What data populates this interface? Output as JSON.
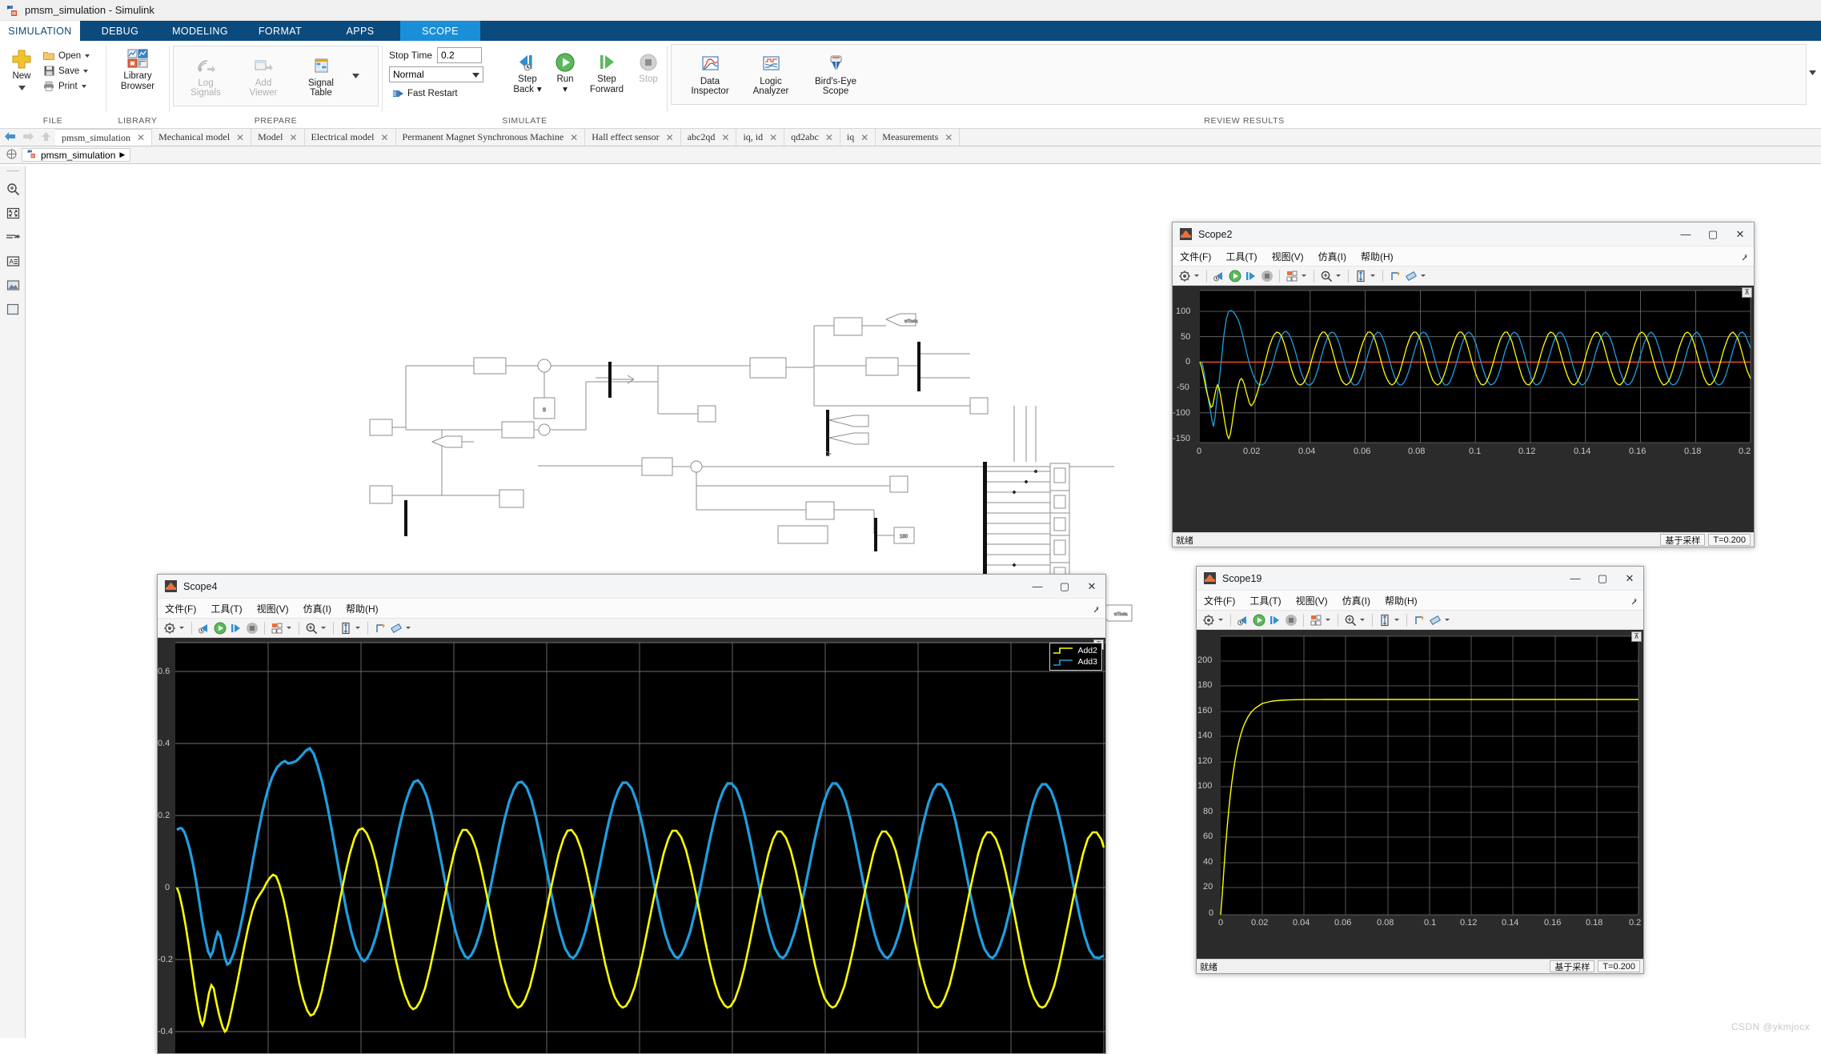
{
  "window": {
    "title": "pmsm_simulation - Simulink",
    "icon": "simulink-icon"
  },
  "ribbon": {
    "tabs": [
      {
        "label": "SIMULATION",
        "state": "active-white"
      },
      {
        "label": "DEBUG",
        "state": "normal"
      },
      {
        "label": "MODELING",
        "state": "normal"
      },
      {
        "label": "FORMAT",
        "state": "normal"
      },
      {
        "label": "APPS",
        "state": "normal"
      },
      {
        "label": "SCOPE",
        "state": "active-blue"
      }
    ],
    "groups": {
      "file": {
        "label": "FILE",
        "new_label": "New",
        "items": [
          {
            "label": "Open",
            "icon": "folder-open-icon",
            "has_caret": true
          },
          {
            "label": "Save",
            "icon": "save-disk-icon",
            "has_caret": true
          },
          {
            "label": "Print",
            "icon": "printer-icon",
            "has_caret": true
          }
        ]
      },
      "library": {
        "label": "LIBRARY",
        "button": {
          "line1": "Library",
          "line2": "Browser",
          "icon": "library-browser-icon"
        }
      },
      "prepare": {
        "label": "PREPARE",
        "buttons": [
          {
            "line1": "Log",
            "line2": "Signals",
            "icon": "log-signals-icon",
            "disabled": true
          },
          {
            "line1": "Add",
            "line2": "Viewer",
            "icon": "add-viewer-icon",
            "disabled": true
          },
          {
            "line1": "Signal",
            "line2": "Table",
            "icon": "signal-table-icon",
            "disabled": false
          }
        ]
      },
      "simulate": {
        "label": "SIMULATE",
        "stop_time_label": "Stop Time",
        "stop_time_value": "0.2",
        "mode_value": "Normal",
        "fast_restart_label": "Fast Restart",
        "buttons": [
          {
            "line1": "Step",
            "line2": "Back",
            "icon": "step-back-icon",
            "has_caret": true,
            "disabled": false
          },
          {
            "line1": "Run",
            "line2": "",
            "icon": "run-icon",
            "has_caret": true,
            "disabled": false
          },
          {
            "line1": "Step",
            "line2": "Forward",
            "icon": "step-forward-icon",
            "has_caret": false,
            "disabled": false
          },
          {
            "line1": "Stop",
            "line2": "",
            "icon": "stop-icon",
            "has_caret": false,
            "disabled": true
          }
        ]
      },
      "review": {
        "label": "REVIEW RESULTS",
        "buttons": [
          {
            "line1": "Data",
            "line2": "Inspector",
            "icon": "data-inspector-icon"
          },
          {
            "line1": "Logic",
            "line2": "Analyzer",
            "icon": "logic-analyzer-icon"
          },
          {
            "line1": "Bird's-Eye",
            "line2": "Scope",
            "icon": "birds-eye-scope-icon"
          }
        ]
      }
    }
  },
  "doc_tabs": [
    {
      "label": "pmsm_simulation",
      "selected": true
    },
    {
      "label": "Mechanical model",
      "selected": false
    },
    {
      "label": "Model",
      "selected": false
    },
    {
      "label": "Electrical model",
      "selected": false
    },
    {
      "label": "Permanent Magnet Synchronous Machine",
      "selected": false
    },
    {
      "label": "Hall effect sensor",
      "selected": false
    },
    {
      "label": "abc2qd",
      "selected": false
    },
    {
      "label": "iq, id",
      "selected": false
    },
    {
      "label": "qd2abc",
      "selected": false
    },
    {
      "label": "iq",
      "selected": false
    },
    {
      "label": "Measurements",
      "selected": false
    }
  ],
  "breadcrumb": {
    "items": [
      "pmsm_simulation"
    ],
    "separator": "▶"
  },
  "left_rail": [
    {
      "name": "zoom-icon"
    },
    {
      "name": "fit-to-view-icon"
    },
    {
      "name": "signal-routing-icon"
    },
    {
      "name": "annotation-icon"
    },
    {
      "name": "image-icon"
    },
    {
      "name": "area-icon"
    }
  ],
  "scopes": [
    {
      "id": "scope2",
      "title": "Scope2",
      "menu": [
        "文件(F)",
        "工具(T)",
        "视图(V)",
        "仿真(I)",
        "帮助(H)"
      ],
      "window_buttons": [
        "minimize",
        "maximize",
        "close"
      ],
      "status_left": "就绪",
      "status_mode": "基于采样",
      "status_time": "T=0.200",
      "has_legend": false
    },
    {
      "id": "scope4",
      "title": "Scope4",
      "menu": [
        "文件(F)",
        "工具(T)",
        "视图(V)",
        "仿真(I)",
        "帮助(H)"
      ],
      "window_buttons": [
        "minimize",
        "maximize",
        "close"
      ],
      "status_left": "",
      "status_mode": "",
      "status_time": "",
      "has_legend": true,
      "legend": [
        {
          "label": "Add2",
          "color": "#ffff00"
        },
        {
          "label": "Add3",
          "color": "#1f9fe0"
        }
      ]
    },
    {
      "id": "scope19",
      "title": "Scope19",
      "menu": [
        "文件(F)",
        "工具(T)",
        "视图(V)",
        "仿真(I)",
        "帮助(H)"
      ],
      "window_buttons": [
        "minimize",
        "maximize",
        "close"
      ],
      "status_left": "就绪",
      "status_mode": "基于采样",
      "status_time": "T=0.200",
      "has_legend": false
    }
  ],
  "chart_data": [
    {
      "id": "scope2",
      "type": "line",
      "title": "Scope2",
      "xlabel": "",
      "ylabel": "",
      "xlim": [
        0,
        0.2
      ],
      "ylim": [
        -175,
        125
      ],
      "xticks": [
        0,
        0.02,
        0.04,
        0.06,
        0.08,
        0.1,
        0.12,
        0.14,
        0.16,
        0.18,
        0.2
      ],
      "xticklabels": [
        "0",
        "0.02",
        "0.04",
        "0.06",
        "0.08",
        "0.1",
        "0.12",
        "0.14",
        "0.16",
        "0.18",
        "0.2"
      ],
      "yticks": [
        100,
        50,
        0,
        -50,
        -100,
        -150
      ],
      "yticklabels": [
        "100",
        "50",
        "0",
        "-50",
        "-100",
        "-150"
      ],
      "grid": true,
      "bg": "#000000",
      "series": [
        {
          "name": "phase-current-blue",
          "color": "#1f9fe0",
          "waveform": "damped-startup-sine",
          "settling_amplitude": 60,
          "startup_peak": 101,
          "startup_min": -135,
          "frequency_hz": 100,
          "phase_deg": 0
        },
        {
          "name": "phase-current-yellow",
          "color": "#ffff00",
          "waveform": "damped-startup-sine",
          "settling_amplitude": 60,
          "startup_peak": 40,
          "startup_min": -165,
          "frequency_hz": 100,
          "phase_deg": 120
        },
        {
          "name": "zero-reference",
          "color": "#ff5020",
          "waveform": "constant",
          "value": 0
        }
      ]
    },
    {
      "id": "scope4",
      "type": "line",
      "title": "Scope4",
      "xlabel": "",
      "ylabel": "",
      "xlim": [
        0,
        0.2
      ],
      "ylim": [
        -0.48,
        0.68
      ],
      "yticks": [
        0.6,
        0.4,
        0.2,
        0,
        -0.2,
        -0.4
      ],
      "yticklabels": [
        "0.6",
        "0.4",
        "0.2",
        "0",
        "-0.2",
        "-0.4"
      ],
      "grid": true,
      "bg": "#000000",
      "legend_position": "top-right",
      "series": [
        {
          "name": "Add2",
          "color": "#ffff00",
          "waveform": "damped-startup-sine",
          "settling_amplitude": 0.3,
          "startup_min": -0.42,
          "frequency_hz": 100,
          "phase_deg": 180
        },
        {
          "name": "Add3",
          "color": "#1f9fe0",
          "waveform": "damped-startup-sine",
          "settling_amplitude": 0.29,
          "startup_peak": 0.37,
          "frequency_hz": 100,
          "phase_deg": 90
        }
      ]
    },
    {
      "id": "scope19",
      "type": "line",
      "title": "Scope19",
      "xlabel": "",
      "ylabel": "",
      "xlim": [
        0,
        0.2
      ],
      "ylim": [
        0,
        210
      ],
      "xticks": [
        0,
        0.02,
        0.04,
        0.06,
        0.08,
        0.1,
        0.12,
        0.14,
        0.16,
        0.18,
        0.2
      ],
      "xticklabels": [
        "0",
        "0.02",
        "0.04",
        "0.06",
        "0.08",
        "0.1",
        "0.12",
        "0.14",
        "0.16",
        "0.18",
        "0.2"
      ],
      "yticks": [
        200,
        180,
        160,
        140,
        120,
        100,
        80,
        60,
        40,
        20,
        0
      ],
      "yticklabels": [
        "200",
        "180",
        "160",
        "140",
        "120",
        "100",
        "80",
        "60",
        "40",
        "20",
        "0"
      ],
      "grid": true,
      "bg": "#000000",
      "series": [
        {
          "name": "speed-rpm",
          "color": "#ffff00",
          "waveform": "first-order-step",
          "final_value": 149,
          "time_constant": 0.01
        }
      ]
    }
  ],
  "watermark": "CSDN @ykmjocx"
}
